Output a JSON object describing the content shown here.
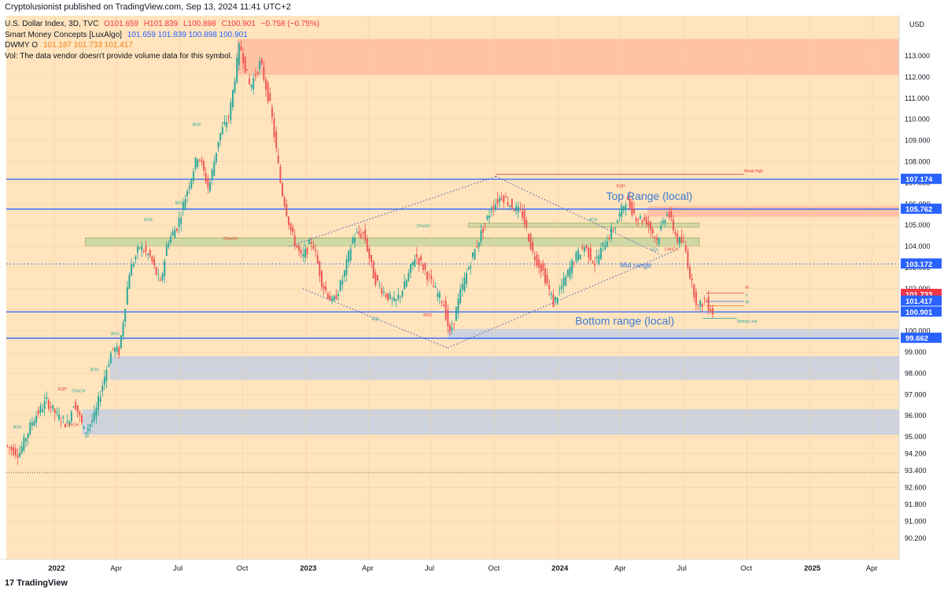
{
  "header": {
    "published": "Cryptolusionist published on TradingView.com, Sep 13, 2024 11:41 UTC+2"
  },
  "legend": {
    "title": "U.S. Dollar Index, 3D, TVC",
    "o": "O101.659",
    "h": "H101.839",
    "l": "L100.898",
    "c": "C100.901",
    "chg": "−0.758 (−0.75%)",
    "smc_label": "Smart Money Concepts [LuxAlgo]",
    "smc_vals": "101.659  101.839  100.898  100.901",
    "dwmy_label": "DWMY O",
    "dwmy_vals": "101.187  101.733  101.417",
    "vol_note": "Vol: The data vendor doesn't provide volume data for this symbol."
  },
  "footer": {
    "brand": "TradingView"
  },
  "colors": {
    "bg_fill": "#ffe0b2",
    "up": "#26a69a",
    "down": "#ef5350",
    "level": "#2962ff",
    "gray_zone": "#c8cfe0"
  },
  "chart_data": {
    "type": "candlestick",
    "title": "U.S. Dollar Index, 3D, TVC",
    "currency": "USD",
    "x_ticks": [
      {
        "label": "2022",
        "year": true,
        "d": 0
      },
      {
        "label": "Apr",
        "year": false,
        "d": 90
      },
      {
        "label": "Jul",
        "year": false,
        "d": 181
      },
      {
        "label": "Oct",
        "year": false,
        "d": 273
      },
      {
        "label": "2023",
        "year": true,
        "d": 365
      },
      {
        "label": "Apr",
        "year": false,
        "d": 455
      },
      {
        "label": "Jul",
        "year": false,
        "d": 546
      },
      {
        "label": "Oct",
        "year": false,
        "d": 638
      },
      {
        "label": "2024",
        "year": true,
        "d": 730
      },
      {
        "label": "Apr",
        "year": false,
        "d": 821
      },
      {
        "label": "Jul",
        "year": false,
        "d": 912
      },
      {
        "label": "Oct",
        "year": false,
        "d": 1004
      },
      {
        "label": "2025",
        "year": true,
        "d": 1096
      },
      {
        "label": "Apr",
        "year": false,
        "d": 1186
      }
    ],
    "y_ticks": [
      90.2,
      91.0,
      91.8,
      92.6,
      93.4,
      94.2,
      95.0,
      96.0,
      97.0,
      98.0,
      99.0,
      100.0,
      101.0,
      102.0,
      103.0,
      104.0,
      105.0,
      106.0,
      107.0,
      108.0,
      109.0,
      110.0,
      111.0,
      112.0,
      113.0
    ],
    "y_tick_labels": [
      "90.200",
      "91.000",
      "91.800",
      "92.600",
      "93.400",
      "94.200",
      "95.000",
      "96.000",
      "97.000",
      "98.000",
      "99.000",
      "100.000",
      "101.000",
      "102.000",
      "103.000",
      "104.000",
      "105.000",
      "106.000",
      "107.000",
      "108.000",
      "109.000",
      "110.000",
      "111.000",
      "112.000",
      "113.000"
    ],
    "x_range_days": [
      -70,
      1225
    ],
    "y_range": [
      89.2,
      114.9
    ],
    "anchors": [
      [
        -70,
        94.6
      ],
      [
        -50,
        94.2
      ],
      [
        -30,
        95.8
      ],
      [
        -10,
        96.7
      ],
      [
        5,
        96.0
      ],
      [
        20,
        95.6
      ],
      [
        30,
        96.7
      ],
      [
        45,
        95.2
      ],
      [
        60,
        96.0
      ],
      [
        75,
        98.0
      ],
      [
        85,
        99.2
      ],
      [
        95,
        99.0
      ],
      [
        110,
        102.8
      ],
      [
        125,
        104.0
      ],
      [
        140,
        103.5
      ],
      [
        155,
        102.2
      ],
      [
        165,
        104.2
      ],
      [
        180,
        105.0
      ],
      [
        195,
        106.8
      ],
      [
        210,
        108.4
      ],
      [
        225,
        106.7
      ],
      [
        240,
        109.2
      ],
      [
        255,
        110.2
      ],
      [
        270,
        113.6
      ],
      [
        285,
        111.5
      ],
      [
        300,
        112.7
      ],
      [
        315,
        110.5
      ],
      [
        330,
        106.8
      ],
      [
        345,
        104.6
      ],
      [
        360,
        103.4
      ],
      [
        375,
        104.3
      ],
      [
        390,
        102.2
      ],
      [
        405,
        101.3
      ],
      [
        420,
        102.5
      ],
      [
        435,
        104.5
      ],
      [
        450,
        104.6
      ],
      [
        465,
        102.5
      ],
      [
        480,
        101.8
      ],
      [
        495,
        101.3
      ],
      [
        510,
        102.2
      ],
      [
        525,
        103.6
      ],
      [
        540,
        102.8
      ],
      [
        555,
        101.8
      ],
      [
        565,
        101.4
      ],
      [
        575,
        99.8
      ],
      [
        590,
        101.8
      ],
      [
        605,
        103.3
      ],
      [
        620,
        104.6
      ],
      [
        635,
        105.8
      ],
      [
        650,
        106.4
      ],
      [
        665,
        105.9
      ],
      [
        680,
        105.5
      ],
      [
        695,
        103.7
      ],
      [
        710,
        102.8
      ],
      [
        725,
        101.3
      ],
      [
        740,
        102.3
      ],
      [
        755,
        103.4
      ],
      [
        770,
        104.0
      ],
      [
        785,
        103.2
      ],
      [
        800,
        104.2
      ],
      [
        815,
        105.0
      ],
      [
        830,
        106.2
      ],
      [
        845,
        105.4
      ],
      [
        860,
        105.2
      ],
      [
        875,
        104.3
      ],
      [
        890,
        105.7
      ],
      [
        905,
        104.3
      ],
      [
        915,
        104.1
      ],
      [
        925,
        102.3
      ],
      [
        935,
        101.1
      ],
      [
        945,
        101.5
      ],
      [
        955,
        100.9
      ]
    ],
    "levels": [
      {
        "label": "107.174",
        "value": 107.174,
        "style": "solid"
      },
      {
        "label": "105.762",
        "value": 105.762,
        "style": "solid"
      },
      {
        "label": "103.172",
        "value": 103.172,
        "style": "dotted"
      },
      {
        "label": "100.901",
        "value": 100.901,
        "style": "solid"
      },
      {
        "label": "99.662",
        "value": 99.662,
        "style": "solid"
      }
    ],
    "price_tags": [
      {
        "label": "101.733",
        "value": 101.733,
        "color": "#f23645"
      },
      {
        "label": "101.417",
        "value": 101.417,
        "color": "#2962ff"
      }
    ],
    "annotations": [
      {
        "text": "Top Range (local)",
        "d": 800,
        "y": 106.2,
        "size": "large"
      },
      {
        "text": "Mid range",
        "d": 820,
        "y": 103.0,
        "size": "small"
      },
      {
        "text": "Bottom range (local)",
        "d": 755,
        "y": 100.3,
        "size": "large"
      }
    ],
    "smc_labels": [
      {
        "text": "BOS",
        "d": -60,
        "y": 95.4,
        "red": false
      },
      {
        "text": "EQH",
        "d": 5,
        "y": 97.2,
        "red": true
      },
      {
        "text": "CHoCH",
        "d": 25,
        "y": 97.1,
        "red": false
      },
      {
        "text": "CHoCH",
        "d": 15,
        "y": 95.5,
        "red": true
      },
      {
        "text": "BOS",
        "d": 52,
        "y": 98.1,
        "red": false
      },
      {
        "text": "BOS",
        "d": 82,
        "y": 99.8,
        "red": false
      },
      {
        "text": "BOS",
        "d": 130,
        "y": 105.2,
        "red": false
      },
      {
        "text": "BOS",
        "d": 200,
        "y": 109.7,
        "red": false
      },
      {
        "text": "BOS",
        "d": 175,
        "y": 106.0,
        "red": false
      },
      {
        "text": "CHoCH",
        "d": 245,
        "y": 104.3,
        "red": true
      },
      {
        "text": "CHoCH",
        "d": 525,
        "y": 104.9,
        "red": false
      },
      {
        "text": "EQL",
        "d": 460,
        "y": 100.5,
        "red": false
      },
      {
        "text": "BOS",
        "d": 535,
        "y": 100.7,
        "red": true
      },
      {
        "text": "EQH",
        "d": 815,
        "y": 106.8,
        "red": true
      },
      {
        "text": "BOS",
        "d": 775,
        "y": 105.2,
        "red": false
      },
      {
        "text": "EQL",
        "d": 865,
        "y": 103.8,
        "red": false
      },
      {
        "text": "CHoCH",
        "d": 885,
        "y": 103.8,
        "red": true
      },
      {
        "text": "Weak High",
        "d": 1000,
        "y": 107.5,
        "red": true
      },
      {
        "text": "Strong Low",
        "d": 990,
        "y": 100.4,
        "red": false
      },
      {
        "text": "M",
        "d": 1002,
        "y": 102.0,
        "red": true
      },
      {
        "text": "Y",
        "d": 1002,
        "y": 101.6,
        "red": false
      },
      {
        "text": "W",
        "d": 1002,
        "y": 101.3,
        "red": false
      }
    ]
  }
}
